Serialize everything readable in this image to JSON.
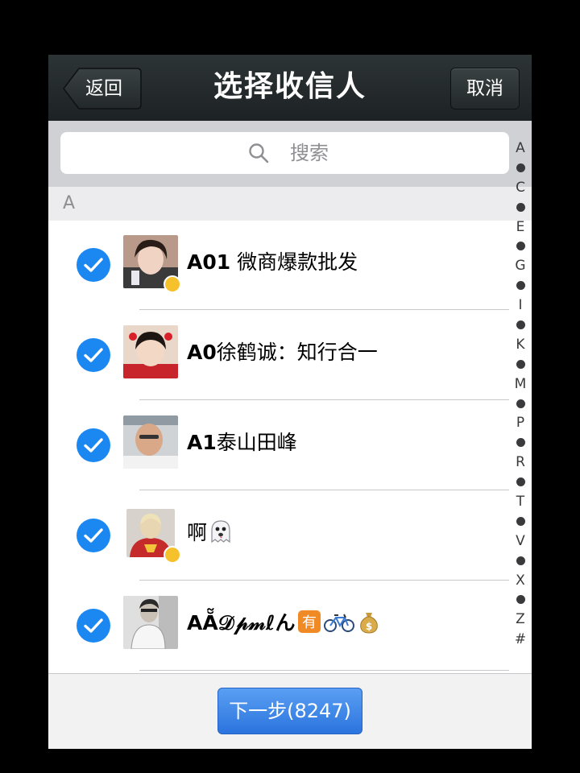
{
  "navbar": {
    "back_label": "返回",
    "title": "选择收信人",
    "cancel_label": "取消"
  },
  "search": {
    "placeholder": "搜索"
  },
  "section": {
    "letter": "A"
  },
  "contacts": [
    {
      "prefix": "A01",
      "name": " 微商爆款批发",
      "checked": true,
      "badge": true
    },
    {
      "prefix": "A0",
      "name": "徐鹤诚：知行合一",
      "checked": true,
      "badge": false
    },
    {
      "prefix": "A1",
      "name": "泰山田峰",
      "checked": true,
      "badge": false
    },
    {
      "prefix": "",
      "name": "啊",
      "checked": true,
      "badge": true,
      "emoji": "ghost-emoji"
    },
    {
      "prefix": "",
      "name": "AẴ𝒟𝓅𝓂ℓん",
      "checked": true,
      "badge": false,
      "emoji": "you-bike-money-emoji"
    }
  ],
  "index_letters": [
    "A",
    "C",
    "E",
    "G",
    "I",
    "K",
    "M",
    "P",
    "R",
    "T",
    "V",
    "X",
    "Z",
    "#"
  ],
  "bottom": {
    "next_label": "下一步(8247)"
  },
  "colors": {
    "navbar": "#2d3436",
    "check": "#1b87f0",
    "next_button": "#2b74de"
  }
}
